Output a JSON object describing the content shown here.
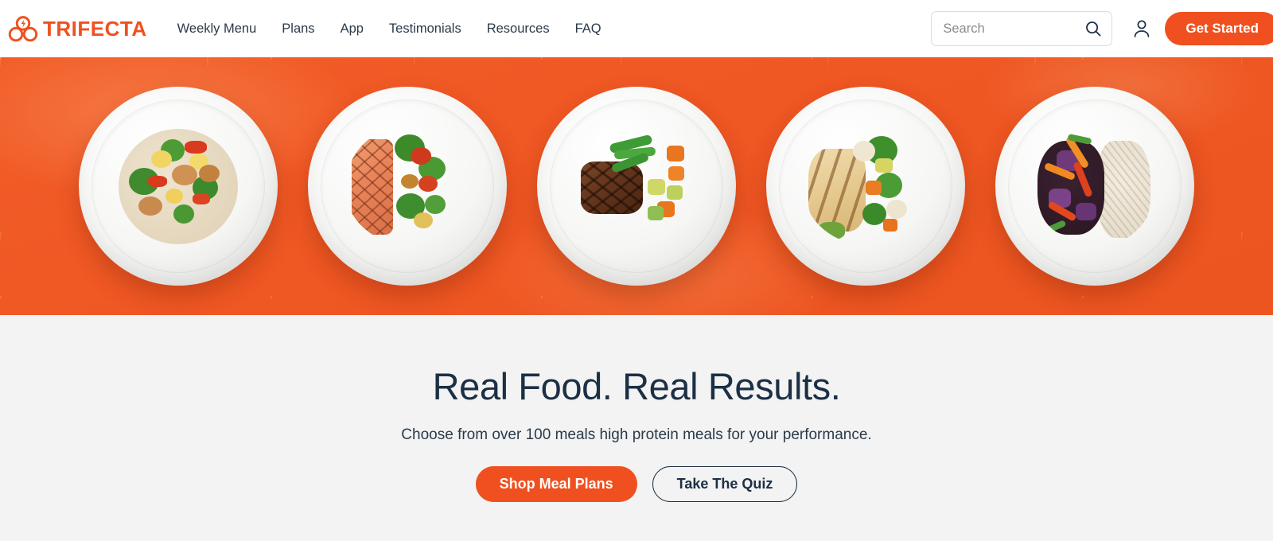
{
  "brand": {
    "name": "TRIFECTA",
    "logo_icon": "trifecta-trefoil-bolt-icon",
    "color": "#f0501f"
  },
  "nav": {
    "items": [
      {
        "label": "Weekly Menu"
      },
      {
        "label": "Plans"
      },
      {
        "label": "App"
      },
      {
        "label": "Testimonials"
      },
      {
        "label": "Resources"
      },
      {
        "label": "FAQ"
      }
    ]
  },
  "search": {
    "placeholder": "Search",
    "value": "",
    "icon": "search-icon"
  },
  "account": {
    "icon": "user-account-icon"
  },
  "header_cta": {
    "label": "Get Started",
    "color": "#f0501f"
  },
  "hero": {
    "background_color": "#ef5723",
    "plates": [
      {
        "name": "Chicken stir fry with pineapple, broccoli and rice"
      },
      {
        "name": "Grilled salmon with roasted vegetables and kale"
      },
      {
        "name": "Grilled steak with green beans, carrots and squash"
      },
      {
        "name": "Sliced grilled chicken with broccoli and cauliflower"
      },
      {
        "name": "Black beans, peppers, cabbage and brown rice"
      }
    ]
  },
  "main": {
    "headline": "Real Food. Real Results.",
    "subhead": "Choose from over 100 meals high protein meals for your performance.",
    "primary_cta": "Shop Meal Plans",
    "secondary_cta": "Take The Quiz",
    "headline_color": "#1c2f45",
    "background_color": "#f2f3f2"
  }
}
